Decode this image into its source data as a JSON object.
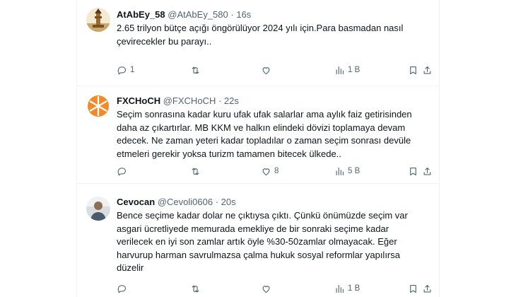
{
  "tweets": [
    {
      "name": "AtAbEy_58",
      "handle": "@AtAbEy_580",
      "time": "16s",
      "lines": [
        "2.65 trilyon bütçe açığı öngörülüyor 2024 yılı için.Para basmadan nasıl",
        "çevirecekler bu parayı.."
      ],
      "replies": "1",
      "retweets": "",
      "likes": "",
      "views": "1 B"
    },
    {
      "name": "FXCHoCH",
      "handle": "@FXCHoCH",
      "time": "22s",
      "lines": [
        "Seçim sonrasına kadar kuru ufak ufak salarlar ama aylık faiz getirisinden",
        "daha az çıkartırlar. MB  KKM ve halkın elindeki dövizi toplamaya devam",
        "edecek. Ne zaman yeteri kadar topladılar o zaman seçim sonrası devüle",
        "etmeleri gerekir yoksa turizm tamamen bitecek ülkede.."
      ],
      "replies": "",
      "retweets": "",
      "likes": "8",
      "views": "5 B"
    },
    {
      "name": "Cevocan",
      "handle": "@Cevoli0606",
      "time": "20s",
      "lines": [
        "Bence seçime kadar dolar ne çıktıysa çıktı. Çünkü  önümüzde seçim var",
        "asgari ücretliyede memurada emekliye de bir sonraki seçime kadar",
        "verilecek en iyi son zamlar artık öyle %30-50zamlar olmayacak. Eğer",
        "harvurup harman savrulmazsa çalma  hukuk sosyal reformlar yapılırsa",
        "düzelir"
      ],
      "replies": "",
      "retweets": "",
      "likes": "",
      "views": "1 B"
    }
  ],
  "separator": "·",
  "icons": {
    "reply": "reply-icon",
    "retweet": "retweet-icon",
    "like": "heart-icon",
    "views": "views-bar-chart-icon",
    "bookmark": "bookmark-icon",
    "share": "share-icon"
  }
}
